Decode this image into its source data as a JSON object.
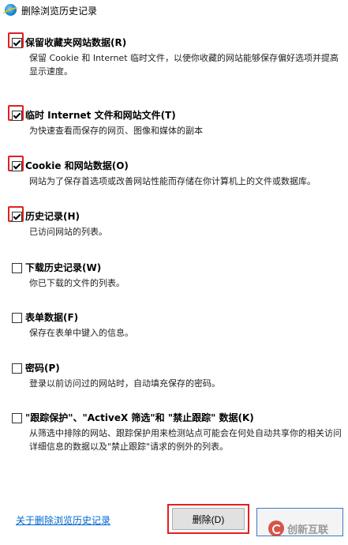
{
  "window": {
    "title": "删除浏览历史记录"
  },
  "options": [
    {
      "label": "保留收藏夹网站数据(R)",
      "desc": "保留 Cookie 和 Internet 临时文件，以使你收藏的网站能够保存偏好选项并提高显示速度。",
      "checked": true
    },
    {
      "label": "临时 Internet 文件和网站文件(T)",
      "desc": "为快速查看而保存的网页、图像和媒体的副本",
      "checked": true
    },
    {
      "label": "Cookie 和网站数据(O)",
      "desc": "网站为了保存首选项或改善网站性能而存储在你计算机上的文件或数据库。",
      "checked": true
    },
    {
      "label": "历史记录(H)",
      "desc": "已访问网站的列表。",
      "checked": true
    },
    {
      "label": "下载历史记录(W)",
      "desc": "你已下载的文件的列表。",
      "checked": false
    },
    {
      "label": "表单数据(F)",
      "desc": "保存在表单中键入的信息。",
      "checked": false
    },
    {
      "label": "密码(P)",
      "desc": "登录以前访问过的网站时，自动填充保存的密码。",
      "checked": false
    },
    {
      "label": "\"跟踪保护\"、\"ActiveX 筛选\"和 \"禁止跟踪\" 数据(K)",
      "desc": "从筛选中排除的网站、跟踪保护用来检测站点可能会在何处自动共享你的相关访问详细信息的数据以及\"禁止跟踪\"请求的例外的列表。",
      "checked": false
    }
  ],
  "footer": {
    "about_link": "关于删除浏览历史记录",
    "delete_button": "删除(D)",
    "watermark": "创新互联"
  }
}
